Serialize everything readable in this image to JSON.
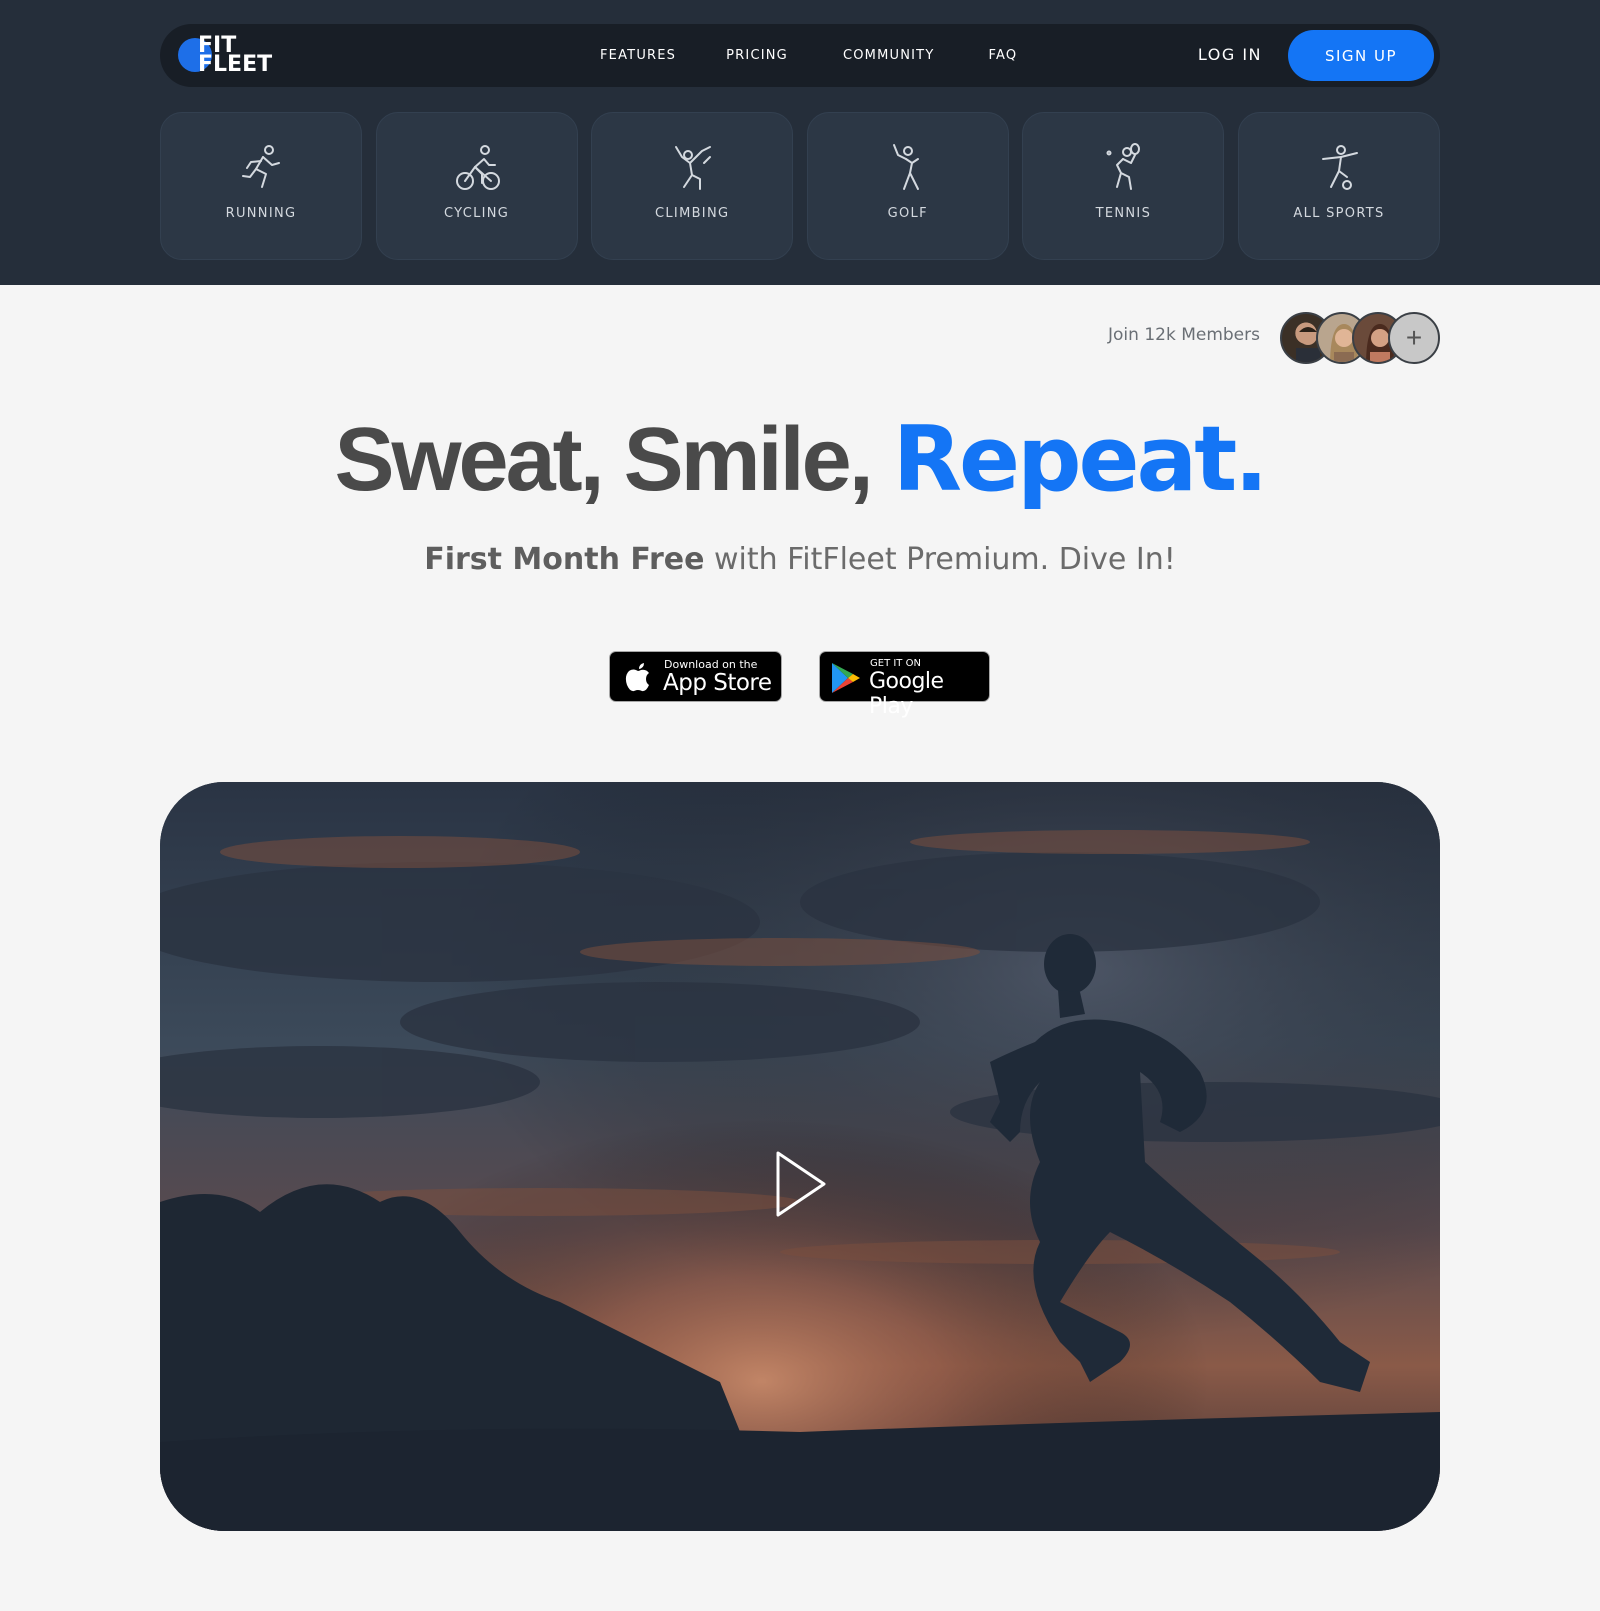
{
  "brand": {
    "line1": "FIT",
    "line2": "FLEET",
    "accent_color": "#1475f5"
  },
  "nav": {
    "links": [
      "FEATURES",
      "PRICING",
      "COMMUNITY",
      "FAQ"
    ],
    "login": "LOG IN",
    "signup": "SIGN UP"
  },
  "sports": [
    {
      "label": "RUNNING",
      "icon": "running-icon"
    },
    {
      "label": "CYCLING",
      "icon": "cycling-icon"
    },
    {
      "label": "CLIMBING",
      "icon": "climbing-icon"
    },
    {
      "label": "GOLF",
      "icon": "golf-icon"
    },
    {
      "label": "TENNIS",
      "icon": "tennis-icon"
    },
    {
      "label": "ALL SPORTS",
      "icon": "soccer-icon"
    }
  ],
  "members": {
    "text": "Join 12k Members",
    "plus": "+"
  },
  "hero": {
    "headline_main": "Sweat, Smile, ",
    "headline_accent": "Repeat.",
    "subtitle_bold": "First Month Free",
    "subtitle_rest": " with FitFleet Premium. Dive In!"
  },
  "stores": {
    "apple_small": "Download on the",
    "apple_big": "App Store",
    "google_small": "GET IT ON",
    "google_big": "Google Play"
  },
  "video": {
    "play_icon": "play-icon"
  }
}
